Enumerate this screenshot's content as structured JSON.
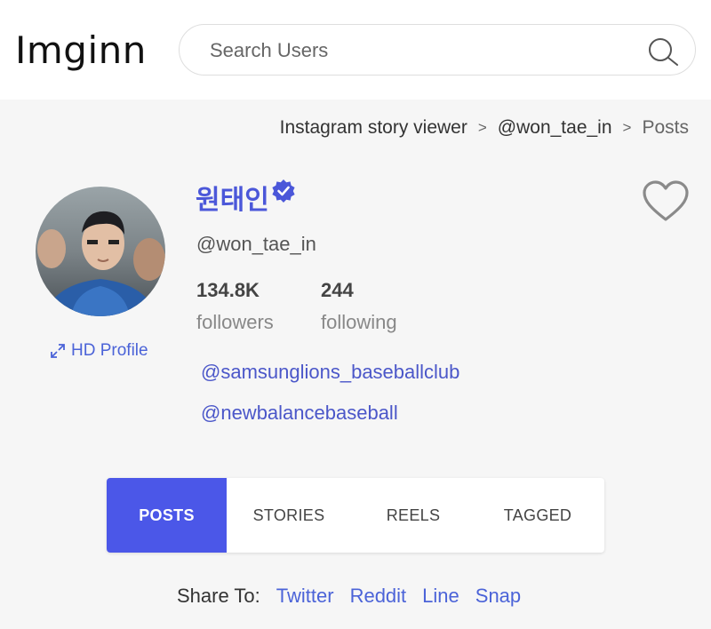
{
  "header": {
    "logo": "Imginn",
    "search_placeholder": "Search Users"
  },
  "breadcrumb": {
    "items": [
      "Instagram story viewer",
      "@won_tae_in",
      "Posts"
    ],
    "separator": ">"
  },
  "profile": {
    "name": "원태인",
    "handle": "@won_tae_in",
    "followers_count": "134.8K",
    "followers_label": "followers",
    "following_count": "244",
    "following_label": "following",
    "hd_profile_label": "HD Profile",
    "bio_links": [
      "@samsunglions_baseballclub",
      "@newbalancebaseball"
    ],
    "verified": true
  },
  "tabs": [
    {
      "label": "POSTS",
      "active": true
    },
    {
      "label": "STORIES",
      "active": false
    },
    {
      "label": "REELS",
      "active": false
    },
    {
      "label": "TAGGED",
      "active": false
    }
  ],
  "share": {
    "label": "Share To:",
    "links": [
      "Twitter",
      "Reddit",
      "Line",
      "Snap"
    ]
  },
  "colors": {
    "accent": "#4b57e8",
    "link": "#4b63d8",
    "verified": "#4b57d9"
  },
  "icons": {
    "search": "search-icon",
    "verified": "verified-badge-icon",
    "heart": "heart-icon",
    "expand": "expand-icon"
  }
}
